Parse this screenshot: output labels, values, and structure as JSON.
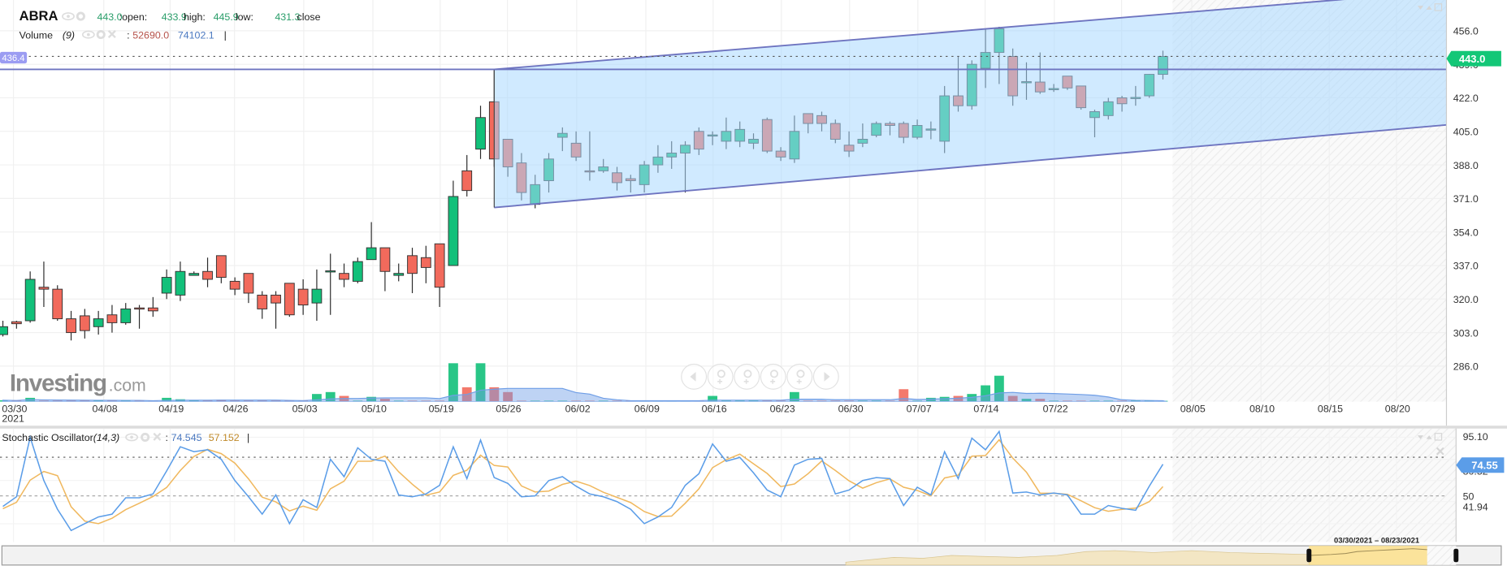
{
  "header": {
    "symbol": "ABRA",
    "price": "443.0",
    "open_label": ":open:",
    "open": "433.9",
    "high_label": "high:",
    "high": "445.9",
    "low_label": "low:",
    "low": "431.3",
    "close_label": "close"
  },
  "volume_legend": {
    "name": "Volume",
    "period": "(9)",
    "sep": ":",
    "value": "52690.0",
    "ma": "74102.1",
    "cursor": "|"
  },
  "stoch_legend": {
    "name": "Stochastic Oscillator",
    "params": "(14,3)",
    "sep": ":",
    "k": "74.545",
    "d": "57.152",
    "cursor": "|"
  },
  "watermark": {
    "main": "Investing",
    "suffix": ".com"
  },
  "navigator": {
    "range": "03/30/2021 – 08/23/2021"
  },
  "icons": {
    "legend": [
      "eye-icon",
      "gear-icon",
      "close-icon"
    ],
    "panel": [
      "chevron-down-icon",
      "chevron-up-icon",
      "maximize-icon",
      "close-icon"
    ],
    "nav_buttons": [
      "scroll-left-icon",
      "zoom-in-icon",
      "zoom-out-icon",
      "zoom-reset-icon",
      "zoom-fit-icon",
      "scroll-right-icon"
    ]
  },
  "colors": {
    "up": "#12c07a",
    "down": "#f26a5c",
    "channel_fill": "#a9d8ff",
    "channel_line": "#6e74c0",
    "last_price_bg": "#13c777",
    "hline_label_bg": "#9b9cf2",
    "stoch_k": "#5b9de8",
    "stoch_d": "#f0b85e",
    "volume_ma": "#6f9ee6",
    "navigator_fill": "#fbe39b"
  },
  "chart_data": [
    {
      "type": "candlestick",
      "ohlc": [
        [
          302,
          309,
          301,
          306
        ],
        [
          308.5,
          309,
          305,
          307.5
        ],
        [
          309,
          334,
          308,
          330
        ],
        [
          326,
          339,
          316,
          325
        ],
        [
          325,
          327,
          309,
          310
        ],
        [
          310,
          314,
          299,
          303
        ],
        [
          311.5,
          315,
          300,
          304
        ],
        [
          306,
          314,
          302,
          310
        ],
        [
          312,
          317,
          303,
          308
        ],
        [
          308,
          318,
          307,
          315
        ],
        [
          315.5,
          317,
          305,
          315
        ],
        [
          315.5,
          321,
          311,
          314
        ],
        [
          323,
          335,
          320,
          331
        ],
        [
          322,
          339,
          319,
          334
        ],
        [
          332,
          334,
          332,
          333
        ],
        [
          334,
          341,
          326,
          330
        ],
        [
          342,
          342,
          328,
          331
        ],
        [
          329,
          331,
          322,
          325
        ],
        [
          333,
          333,
          318,
          323
        ],
        [
          322,
          324,
          310,
          315
        ],
        [
          322,
          324,
          305,
          318
        ],
        [
          328,
          328,
          311,
          312
        ],
        [
          325,
          330,
          312,
          317
        ],
        [
          318,
          335,
          309,
          325
        ],
        [
          334,
          343,
          312,
          334.3
        ],
        [
          333,
          338,
          326,
          330
        ],
        [
          329,
          341,
          328,
          339
        ],
        [
          340,
          359,
          340,
          346
        ],
        [
          346,
          346,
          324,
          334
        ],
        [
          332,
          338,
          329,
          333
        ],
        [
          342,
          346,
          323,
          333
        ],
        [
          341,
          347,
          328,
          336
        ],
        [
          348,
          348,
          316,
          326
        ],
        [
          337,
          380,
          337,
          372
        ],
        [
          385,
          393,
          372,
          375
        ],
        [
          396,
          418,
          391,
          412
        ],
        [
          420,
          436.4,
          387,
          391
        ],
        [
          401,
          401,
          382,
          387
        ],
        [
          389,
          394,
          370,
          374
        ],
        [
          368,
          383,
          366,
          378
        ],
        [
          380,
          394,
          374,
          391
        ],
        [
          402,
          407,
          395,
          404
        ],
        [
          399,
          405,
          390,
          392
        ],
        [
          385,
          405,
          380,
          384.5
        ],
        [
          385,
          391,
          384,
          387
        ],
        [
          384,
          387,
          375,
          379
        ],
        [
          381,
          383,
          374,
          380
        ],
        [
          378,
          390,
          374,
          388
        ],
        [
          388,
          398,
          384,
          392
        ],
        [
          392,
          400,
          386,
          394
        ],
        [
          394,
          400,
          374,
          398
        ],
        [
          405,
          407,
          393,
          396
        ],
        [
          403,
          405,
          398,
          403.2
        ],
        [
          400,
          412,
          396,
          405
        ],
        [
          400,
          410,
          397,
          406
        ],
        [
          399,
          404,
          396,
          401
        ],
        [
          411,
          412,
          394,
          395
        ],
        [
          395,
          397,
          390,
          392
        ],
        [
          391,
          413,
          389,
          405
        ],
        [
          414,
          414,
          404,
          409
        ],
        [
          413,
          415,
          405,
          409
        ],
        [
          409,
          411,
          399,
          401
        ],
        [
          398,
          405,
          392,
          395
        ],
        [
          399,
          409,
          397,
          401
        ],
        [
          403,
          410,
          402,
          409
        ],
        [
          409,
          410,
          403,
          408
        ],
        [
          409,
          410,
          399,
          402
        ],
        [
          402,
          411,
          401,
          408
        ],
        [
          406,
          410,
          401,
          406.2
        ],
        [
          400,
          428,
          394,
          423
        ],
        [
          423,
          443,
          415,
          418
        ],
        [
          418,
          441,
          416,
          439
        ],
        [
          437,
          457,
          427,
          445
        ],
        [
          445,
          458,
          429,
          457
        ],
        [
          443,
          447,
          418,
          423
        ],
        [
          430,
          440,
          421,
          430.2
        ],
        [
          430,
          445,
          424,
          425
        ],
        [
          426.5,
          429,
          425,
          426.7
        ],
        [
          433,
          433,
          426,
          427
        ],
        [
          428,
          428,
          416,
          417
        ],
        [
          412,
          416,
          402,
          415
        ],
        [
          413,
          422,
          411,
          420
        ],
        [
          422,
          423,
          415,
          419
        ],
        [
          422,
          428,
          418,
          422.2
        ],
        [
          423,
          434,
          422,
          433.9
        ],
        [
          433.9,
          445.9,
          431.3,
          443.0
        ]
      ],
      "ylim": [
        286,
        456
      ],
      "y_ticks": [
        "456.0",
        "439.0",
        "422.0",
        "405.0",
        "388.0",
        "371.0",
        "354.0",
        "337.0",
        "320.0",
        "303.0",
        "286.0"
      ],
      "x_ticks": [
        "03/30",
        "04/08",
        "04/19",
        "04/26",
        "05/03",
        "05/10",
        "05/19",
        "05/26",
        "06/02",
        "06/09",
        "06/16",
        "06/23",
        "06/30",
        "07/07",
        "07/14",
        "07/22",
        "07/29",
        "08/05",
        "08/10",
        "08/15",
        "08/20"
      ],
      "year_label": "2021",
      "last_price": "443.0",
      "horizontal_line": {
        "price": 436.4,
        "label": "436.4"
      },
      "channel": {
        "upper": [
          [
            36,
            436.4
          ],
          [
            97.7,
            471.6
          ]
        ],
        "lower": [
          [
            36,
            366.4
          ],
          [
            105.8,
            408.3
          ]
        ]
      },
      "grid": true
    },
    {
      "type": "bar",
      "series": [
        {
          "name": "Volume",
          "values": [
            90000,
            60000,
            240000,
            60000,
            60000,
            60000,
            60000,
            60000,
            60000,
            60000,
            60000,
            60000,
            240000,
            150000,
            60000,
            60000,
            120000,
            60000,
            60000,
            60000,
            60000,
            60000,
            60000,
            480000,
            600000,
            360000,
            60000,
            300000,
            180000,
            60000,
            60000,
            60000,
            60000,
            2400000,
            900000,
            2400000,
            900000,
            600000,
            60000,
            60000,
            60000,
            60000,
            60000,
            60000,
            60000,
            60000,
            60000,
            60000,
            60000,
            60000,
            60000,
            60000,
            360000,
            60000,
            60000,
            60000,
            60000,
            60000,
            600000,
            60000,
            60000,
            60000,
            60000,
            60000,
            60000,
            60000,
            780000,
            60000,
            240000,
            300000,
            360000,
            480000,
            1020000,
            1620000,
            360000,
            180000,
            180000,
            60000,
            60000,
            60000,
            60000,
            60000,
            60000,
            60000,
            60000,
            52690
          ]
        }
      ],
      "ma_period": 9
    },
    {
      "type": "line",
      "series": [
        {
          "name": "%K",
          "values": [
            41.8,
            49.3,
            95.5,
            61.9,
            39.6,
            23.1,
            28.4,
            33.6,
            35.8,
            48.5,
            48.5,
            51.5,
            69.4,
            88.1,
            84.3,
            85.8,
            78.4,
            61.9,
            49.3,
            35.8,
            50.7,
            28.4,
            47.0,
            41.0,
            78.4,
            64.9,
            87.3,
            78.4,
            76.9,
            50.7,
            49.3,
            51.5,
            58.2,
            88.1,
            63.4,
            93.3,
            64.2,
            59.7,
            49.3,
            50.0,
            61.9,
            64.9,
            57.5,
            51.5,
            49.3,
            45.5,
            39.6,
            28.4,
            33.6,
            41.0,
            58.2,
            67.2,
            90.3,
            76.9,
            79.9,
            67.9,
            54.5,
            49.3,
            73.9,
            78.4,
            79.1,
            51.5,
            54.5,
            61.9,
            64.2,
            63.4,
            42.5,
            56.7,
            50.7,
            84.3,
            63.4,
            94.8,
            85.8,
            100,
            52.2,
            53.0,
            50.7,
            52.2,
            50.7,
            35.8,
            35.8,
            42.5,
            40.3,
            38.8,
            57.5,
            74.545
          ]
        },
        {
          "name": "%D",
          "values": [
            40,
            45,
            62.2,
            68.9,
            65.7,
            41.5,
            30.4,
            28.4,
            32.6,
            39.3,
            44.3,
            49.5,
            56.5,
            69.7,
            80.6,
            86.1,
            82.8,
            75.4,
            63.2,
            49.0,
            45.3,
            38.3,
            42.0,
            38.8,
            55.5,
            61.4,
            76.9,
            76.9,
            80.9,
            68.7,
            59.0,
            50.5,
            53.0,
            65.9,
            69.9,
            81.6,
            73.6,
            72.4,
            57.7,
            53.0,
            53.7,
            58.9,
            61.4,
            58.0,
            52.8,
            48.8,
            44.8,
            37.8,
            33.9,
            34.3,
            44.3,
            55.5,
            71.9,
            78.1,
            82.4,
            74.9,
            67.4,
            57.2,
            59.2,
            67.2,
            77.1,
            69.7,
            61.7,
            56.0,
            60.2,
            63.2,
            56.7,
            54.2,
            50.0,
            63.9,
            66.1,
            80.8,
            81.3,
            93.5,
            79.3,
            68.4,
            52.0,
            52.0,
            51.2,
            46.2,
            40.8,
            38.0,
            39.5,
            40.5,
            45.5,
            57.152
          ]
        }
      ],
      "y_ticks": [
        "95.10",
        "80.52",
        "50",
        "41.94"
      ],
      "current_label": "74.55",
      "levels": [
        80,
        50
      ]
    }
  ]
}
